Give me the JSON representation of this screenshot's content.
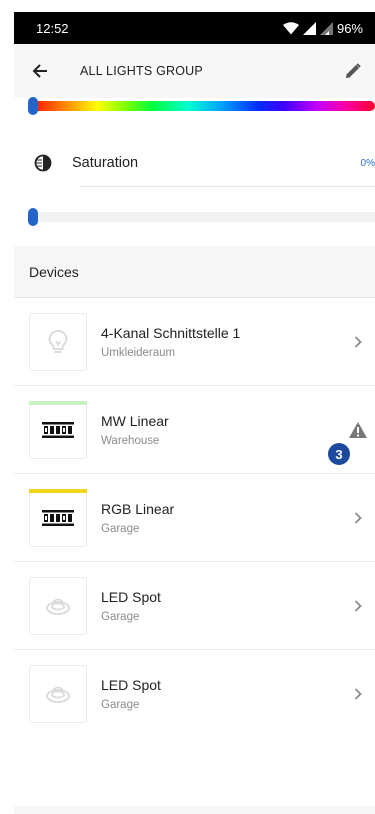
{
  "status_bar": {
    "time": "12:52",
    "battery": "96%"
  },
  "app_bar": {
    "title": "ALL LIGHTS GROUP"
  },
  "hue_slider": {
    "value": 0
  },
  "saturation": {
    "label": "Saturation",
    "value_text": "0%",
    "value": 0
  },
  "devices_section": {
    "title": "Devices"
  },
  "devices": [
    {
      "name": "4-Kanal Schnittstelle 1",
      "room": "Umkleideraum",
      "icon": "lightbulb-icon",
      "accent_color": null,
      "action": "chevron-right-icon"
    },
    {
      "name": "MW Linear",
      "room": "Warehouse",
      "icon": "linear-led-icon",
      "accent_color": "#c9f0c2",
      "action": "warning-icon",
      "badge": "3"
    },
    {
      "name": "RGB Linear",
      "room": "Garage",
      "icon": "linear-led-icon",
      "accent_color": "#f2d51d",
      "action": "chevron-right-icon"
    },
    {
      "name": "LED Spot",
      "room": "Garage",
      "icon": "spot-light-icon",
      "accent_color": null,
      "action": "chevron-right-icon"
    },
    {
      "name": "LED Spot",
      "room": "Garage",
      "icon": "spot-light-icon",
      "accent_color": null,
      "action": "chevron-right-icon"
    }
  ],
  "colors": {
    "accent": "#2464c8",
    "badge": "#1c4a9c",
    "value_text": "#2a6fd0"
  }
}
